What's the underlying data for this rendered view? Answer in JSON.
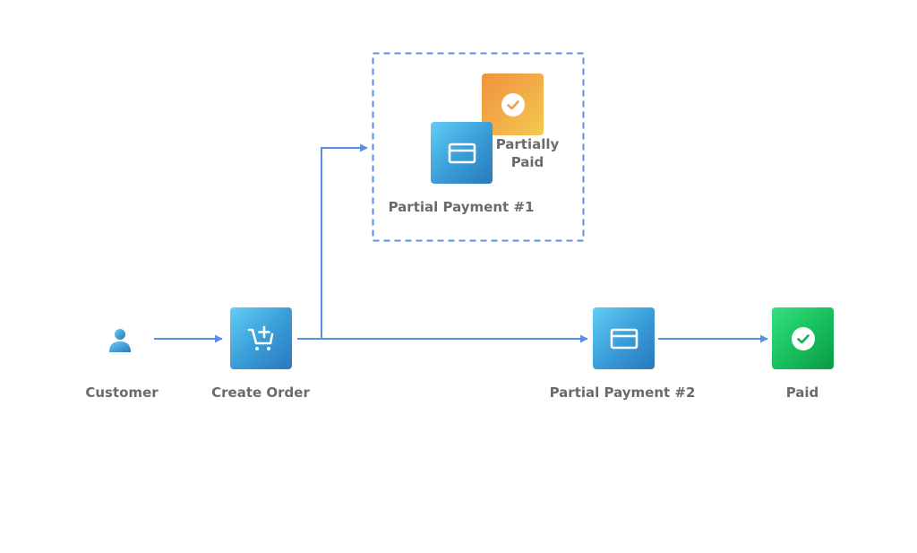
{
  "diagram": {
    "nodes": {
      "customer": {
        "label": "Customer",
        "icon": "user-icon"
      },
      "create_order": {
        "label": "Create Order",
        "icon": "cart-add-icon"
      },
      "partial_payment_1": {
        "label": "Partial Payment #1",
        "icon": "credit-card-icon"
      },
      "partially_paid": {
        "label_line1": "Partially",
        "label_line2": "Paid",
        "icon": "check-circle-icon"
      },
      "partial_payment_2": {
        "label": "Partial Payment #2",
        "icon": "credit-card-icon"
      },
      "paid": {
        "label": "Paid",
        "icon": "check-circle-icon"
      }
    },
    "edges": [
      {
        "from": "customer",
        "to": "create_order"
      },
      {
        "from": "create_order",
        "to": "partial_payment_1"
      },
      {
        "from": "create_order",
        "to": "partial_payment_2"
      },
      {
        "from": "partial_payment_2",
        "to": "paid"
      }
    ],
    "colors": {
      "arrow": "#5b8fe6",
      "label": "#6b6b6b",
      "blue_node": "#3a9fd8",
      "green_node": "#19c05e",
      "orange_node": "#f2ac47"
    }
  }
}
